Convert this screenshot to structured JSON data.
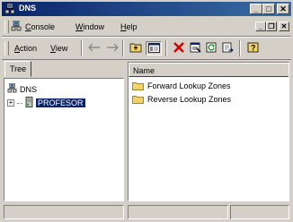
{
  "window": {
    "title": "DNS"
  },
  "menubar": {
    "items": [
      {
        "label_u": "C",
        "label_rest": "onsole"
      },
      {
        "label_u": "W",
        "label_rest": "indow"
      },
      {
        "label_u": "H",
        "label_rest": "elp"
      }
    ]
  },
  "toolbar": {
    "action_u": "A",
    "action_rest": "ction",
    "view_u": "V",
    "view_rest": "iew"
  },
  "tree": {
    "tab_label": "Tree",
    "root": "DNS",
    "server": "PROFESOR"
  },
  "list": {
    "column_name": "Name",
    "items": [
      "Forward Lookup Zones",
      "Reverse Lookup Zones"
    ]
  },
  "colors": {
    "title_start": "#0a246a",
    "title_end": "#3a6ea5",
    "selection": "#0a246a",
    "folder": "#f2d36b"
  }
}
